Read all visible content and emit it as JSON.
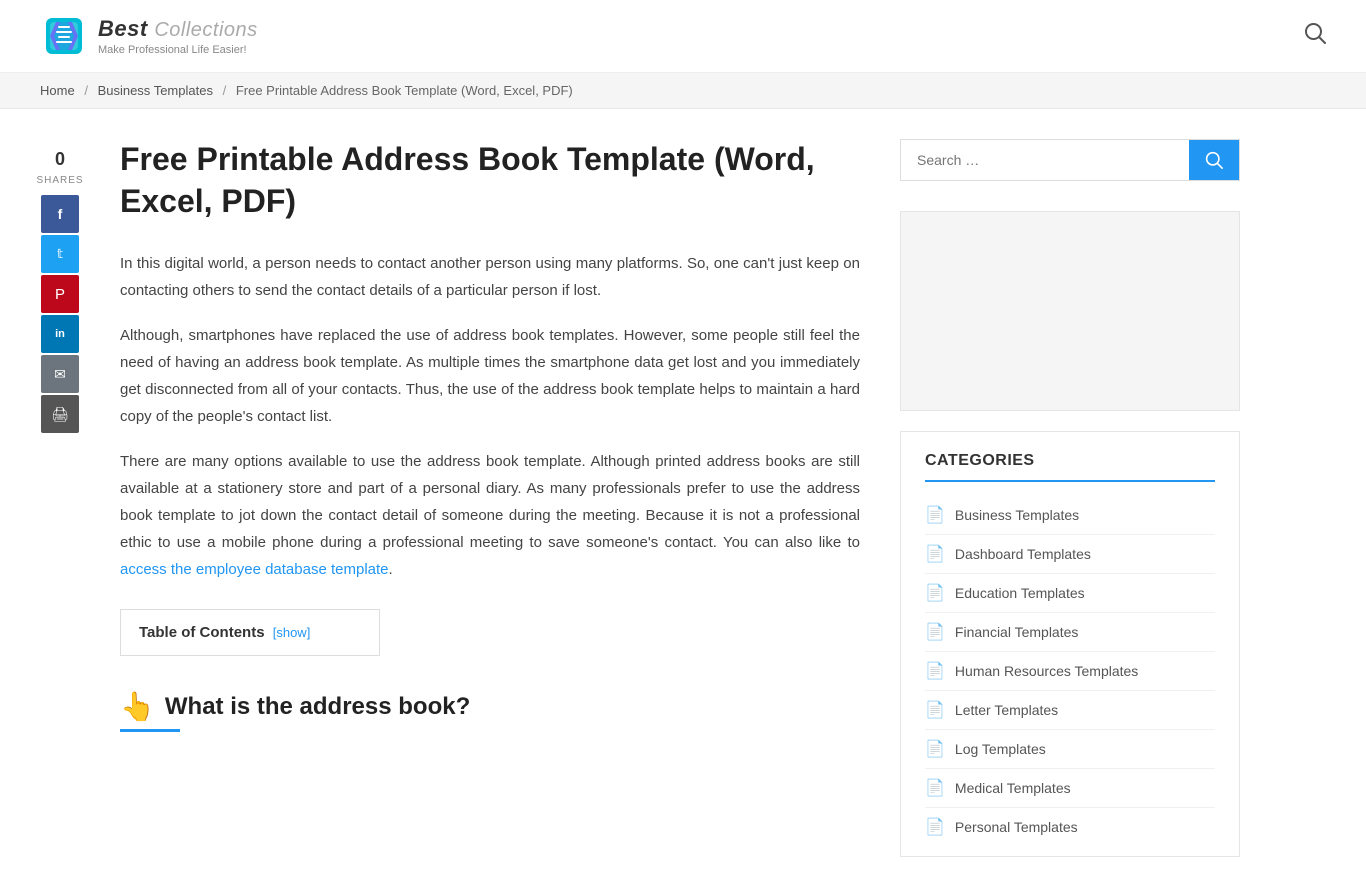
{
  "header": {
    "logo_best": "Best",
    "logo_collections": "Collections",
    "logo_subtitle": "Make Professional Life Easier!",
    "search_icon": "🔍"
  },
  "breadcrumb": {
    "home": "Home",
    "separator1": "/",
    "business_templates": "Business Templates",
    "separator2": "/",
    "current": "Free Printable Address Book Template (Word, Excel, PDF)"
  },
  "social": {
    "shares_count": "0",
    "shares_label": "SHARES",
    "facebook_icon": "f",
    "twitter_icon": "t",
    "pinterest_icon": "p",
    "linkedin_icon": "in",
    "email_icon": "✉",
    "print_icon": "🖨"
  },
  "article": {
    "title": "Free Printable Address Book Template (Word, Excel, PDF)",
    "paragraph1": "In this digital world, a person needs to contact another person using many platforms. So, one can't just keep on contacting others to send the contact details of a particular person if lost.",
    "paragraph2": "Although, smartphones have replaced the use of address book templates. However, some people still feel the need of having an address book template. As multiple times the smartphone data get lost and you immediately get disconnected from all of your contacts. Thus, the use of the address book template helps to maintain a hard copy of the people's contact list.",
    "paragraph3_prefix": "There are many options available to use the address book template. Although printed address books are still available at a stationery store and part of a personal diary. As many professionals prefer to use the address book template to jot down the contact detail of someone during the meeting. Because it is not a professional ethic to use a mobile phone during a professional meeting to save someone's contact. You can also like to ",
    "paragraph3_link_text": "access the employee database template",
    "paragraph3_suffix": ".",
    "toc_title": "Table of Contents",
    "toc_toggle": "[show]",
    "section_title": "What is the address book?"
  },
  "sidebar": {
    "search_placeholder": "Search …",
    "search_button_icon": "🔍",
    "categories_title": "CATEGORIES",
    "categories": [
      {
        "label": "Business Templates"
      },
      {
        "label": "Dashboard Templates"
      },
      {
        "label": "Education Templates"
      },
      {
        "label": "Financial Templates"
      },
      {
        "label": "Human Resources Templates"
      },
      {
        "label": "Letter Templates"
      },
      {
        "label": "Log Templates"
      },
      {
        "label": "Medical Templates"
      },
      {
        "label": "Personal Templates"
      }
    ]
  }
}
